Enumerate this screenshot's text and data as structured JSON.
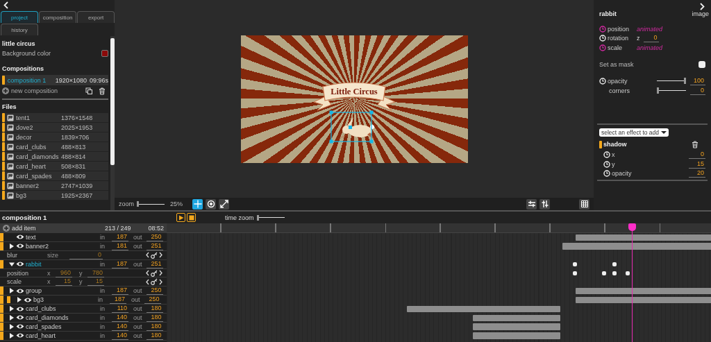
{
  "left_panel": {
    "tabs": [
      {
        "label": "project",
        "selected": true
      },
      {
        "label": "composition",
        "selected": false
      },
      {
        "label": "export",
        "selected": false
      },
      {
        "label": "history",
        "selected": false
      }
    ],
    "project_title": "little circus",
    "background": {
      "label": "Background color",
      "color": "#8b0a0a"
    },
    "compositions": {
      "heading": "Compositions",
      "items": [
        {
          "name": "composition 1",
          "size": "1920×1080",
          "duration": "09:96s",
          "selected": true
        }
      ],
      "new_label": "new composition"
    },
    "files": {
      "heading": "Files",
      "items": [
        {
          "name": "tent1",
          "size": "1376×1548"
        },
        {
          "name": "dove2",
          "size": "2025×1953"
        },
        {
          "name": "decor",
          "size": "1839×706"
        },
        {
          "name": "card_clubs",
          "size": "488×813"
        },
        {
          "name": "card_diamonds",
          "size": "488×814"
        },
        {
          "name": "card_heart",
          "size": "508×831"
        },
        {
          "name": "card_spades",
          "size": "488×809"
        },
        {
          "name": "banner2",
          "size": "2747×1039"
        },
        {
          "name": "bg3",
          "size": "1925×2367"
        }
      ]
    }
  },
  "viewer": {
    "title_text": "Little Circus",
    "zoom_label": "zoom",
    "zoom": {
      "level": 0
    },
    "zoom_reading": "25%",
    "tools": [
      {
        "kind": "move",
        "selected": true
      },
      {
        "kind": "rotate",
        "selected": false
      },
      {
        "kind": "resize",
        "selected": false
      }
    ]
  },
  "inspector": {
    "title": "rabbit",
    "type": "image",
    "properties": [
      {
        "name": "position",
        "animated": true,
        "value": "animated"
      },
      {
        "name": "rotation",
        "animated": false,
        "axis": "z",
        "value": "0"
      },
      {
        "name": "scale",
        "animated": true,
        "value": "animated"
      }
    ],
    "mask": {
      "label": "Set as mask",
      "on": false
    },
    "sliders": [
      {
        "name": "opacity",
        "clock": true,
        "level": 1,
        "value": "100"
      },
      {
        "name": "corners",
        "clock": false,
        "level": 0,
        "value": "0"
      }
    ],
    "effect_select": "select an effect to add",
    "effects": [
      {
        "name": "shadow",
        "params": [
          {
            "name": "x",
            "value": "0"
          },
          {
            "name": "y",
            "value": "15"
          },
          {
            "name": "opacity",
            "value": "20"
          }
        ]
      }
    ]
  },
  "timeline": {
    "title": "composition 1",
    "time_zoom_label": "time zoom",
    "time_zoom": {
      "level": 0
    },
    "add_label": "add item",
    "frame": "213 / 249",
    "time": "08:52",
    "playhead": {
      "level": 0.855
    },
    "layers": [
      {
        "name": "text",
        "in_label": "in",
        "in": "187",
        "out_label": "out",
        "out": "250",
        "selected": false
      },
      {
        "name": "banner2",
        "expanded": false,
        "in_label": "in",
        "in": "181",
        "out_label": "out",
        "out": "251",
        "selected": false,
        "properties": [
          {
            "name": "blur",
            "fields": [
              {
                "label": "size",
                "value": "0"
              }
            ]
          }
        ]
      },
      {
        "name": "rabbit",
        "expanded": true,
        "in_label": "in",
        "in": "187",
        "out_label": "out",
        "out": "251",
        "selected": true,
        "keyframes": [
          {
            "level": 0.75
          },
          {
            "level": 0.823
          }
        ],
        "properties": [
          {
            "name": "position",
            "fields": [
              {
                "label": "x",
                "value": "960"
              },
              {
                "label": "y",
                "value": "780"
              }
            ],
            "keyframes": [
              {
                "level": 0.75
              },
              {
                "level": 0.804
              },
              {
                "level": 0.823
              },
              {
                "level": 0.847
              }
            ]
          },
          {
            "name": "scale",
            "fields": [
              {
                "label": "x",
                "value": "15"
              },
              {
                "label": "y",
                "value": "15"
              }
            ]
          }
        ]
      },
      {
        "name": "group",
        "expanded": false,
        "in_label": "in",
        "in": "187",
        "out_label": "out",
        "out": "250",
        "selected": false,
        "children": [
          {
            "name": "bg3",
            "expanded": false,
            "in_label": "in",
            "in": "187",
            "out_label": "out",
            "out": "250",
            "selected": false
          }
        ]
      },
      {
        "name": "card_clubs",
        "expanded": false,
        "in_label": "in",
        "in": "110",
        "out_label": "out",
        "out": "180",
        "selected": false
      },
      {
        "name": "card_diamonds",
        "expanded": false,
        "in_label": "in",
        "in": "140",
        "out_label": "out",
        "out": "180",
        "selected": false
      },
      {
        "name": "card_spades",
        "expanded": false,
        "in_label": "in",
        "in": "140",
        "out_label": "out",
        "out": "180",
        "selected": false
      },
      {
        "name": "card_heart",
        "expanded": false,
        "in_label": "in",
        "in": "140",
        "out_label": "out",
        "out": "180",
        "selected": false
      }
    ]
  }
}
